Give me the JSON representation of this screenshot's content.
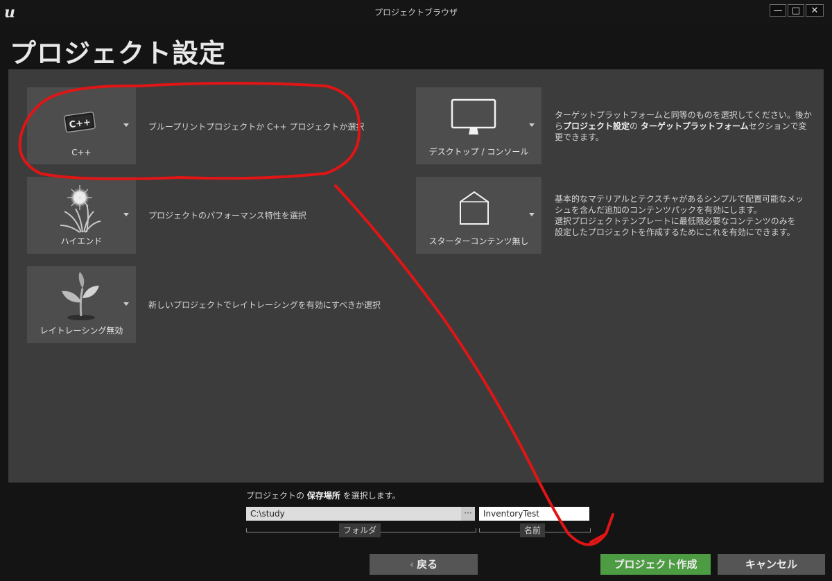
{
  "window": {
    "title": "プロジェクトブラウザ",
    "logo_text": "u",
    "minimize_glyph": "—",
    "maximize_glyph": "□",
    "close_glyph": "✕"
  },
  "page_title": "プロジェクト設定",
  "options_left": [
    {
      "label": "C++",
      "icon": "cpp-icon",
      "desc": "ブループリントプロジェクトか C++ プロジェクトか選択"
    },
    {
      "label": "ハイエンド",
      "icon": "high-end-icon",
      "desc": "プロジェクトのパフォーマンス特性を選択"
    },
    {
      "label": "レイトレーシング無効",
      "icon": "raytracing-plant-icon",
      "desc": "新しいプロジェクトでレイトレーシングを有効にすべきか選択"
    }
  ],
  "options_right": [
    {
      "label": "デスクトップ / コンソール",
      "icon": "desktop-monitor-icon",
      "desc_line1": "ターゲットプラットフォームと同等のものを選択してください。後か",
      "desc_line2_pre": "ら",
      "desc_line2_b1": "プロジェクト設定",
      "desc_line2_mid": "の ",
      "desc_line2_b2": "ターゲットプラットフォーム",
      "desc_line2_post": "セクションで変",
      "desc_line3": "更できます。"
    },
    {
      "label": "スターターコンテンツ無し",
      "icon": "starter-box-icon",
      "desc_lines": [
        "基本的なマテリアルとテクスチャがあるシンプルで配置可能なメッ",
        "シュを含んだ追加のコンテンツパックを有効にします。",
        "選択プロジェクトテンプレートに最低限必要なコンテンツのみを",
        "設定したプロジェクトを作成するためにこれを有効にできます。"
      ]
    }
  ],
  "location": {
    "pre": "プロジェクトの ",
    "bold": "保存場所",
    "post": " を選択します。",
    "folder_value": "C:\\study",
    "browse_glyph": "···",
    "name_value": "InventoryTest",
    "folder_label": "フォルダ",
    "name_label": "名前"
  },
  "buttons": {
    "back": "戻る",
    "back_glyph": "‹",
    "create": "プロジェクト作成",
    "cancel": "キャンセル"
  },
  "annotation_color": "#e01515"
}
